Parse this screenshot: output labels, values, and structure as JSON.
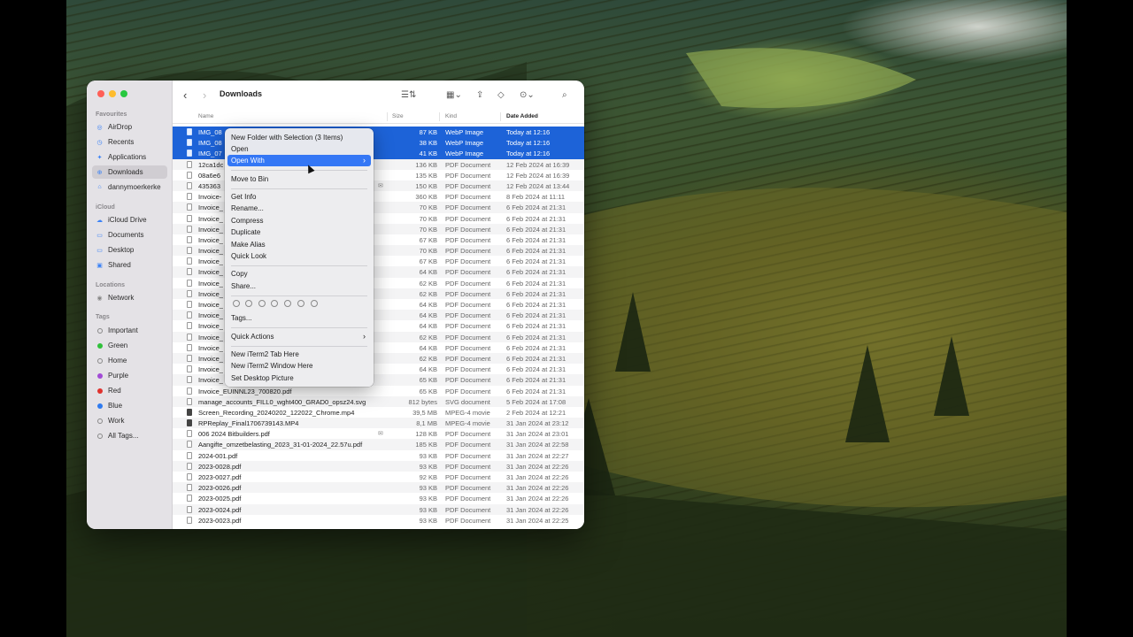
{
  "window": {
    "title": "Downloads"
  },
  "sidebar": {
    "favourites_label": "Favourites",
    "favourites": [
      {
        "label": "AirDrop",
        "icon": "airdrop-icon"
      },
      {
        "label": "Recents",
        "icon": "clock-icon"
      },
      {
        "label": "Applications",
        "icon": "applications-icon"
      },
      {
        "label": "Downloads",
        "icon": "download-icon",
        "active": true
      },
      {
        "label": "dannymoerkerke",
        "icon": "home-icon"
      }
    ],
    "icloud_label": "iCloud",
    "icloud": [
      {
        "label": "iCloud Drive",
        "icon": "cloud-icon"
      },
      {
        "label": "Documents",
        "icon": "document-icon"
      },
      {
        "label": "Desktop",
        "icon": "desktop-icon"
      },
      {
        "label": "Shared",
        "icon": "shared-folder-icon"
      }
    ],
    "locations_label": "Locations",
    "locations": [
      {
        "label": "Network",
        "icon": "network-icon"
      }
    ],
    "tags_label": "Tags",
    "tags": [
      {
        "label": "Important",
        "color": ""
      },
      {
        "label": "Green",
        "color": "#30c13b"
      },
      {
        "label": "Home",
        "color": ""
      },
      {
        "label": "Purple",
        "color": "#a24bd6"
      },
      {
        "label": "Red",
        "color": "#e0322e"
      },
      {
        "label": "Blue",
        "color": "#2f7bf0"
      },
      {
        "label": "Work",
        "color": ""
      },
      {
        "label": "All Tags...",
        "color": ""
      }
    ]
  },
  "columns": {
    "name": "Name",
    "size": "Size",
    "kind": "Kind",
    "date": "Date Added"
  },
  "files": [
    {
      "name": "IMG_08",
      "size": "87 KB",
      "kind": "WebP Image",
      "date": "Today at 12:16",
      "selected": true
    },
    {
      "name": "IMG_08",
      "size": "38 KB",
      "kind": "WebP Image",
      "date": "Today at 12:16",
      "selected": true
    },
    {
      "name": "IMG_07",
      "size": "41 KB",
      "kind": "WebP Image",
      "date": "Today at 12:16",
      "selected": true
    },
    {
      "name": "12ca1dc",
      "size": "136 KB",
      "kind": "PDF Document",
      "date": "12 Feb 2024 at 16:39"
    },
    {
      "name": "08a6e6",
      "size": "135 KB",
      "kind": "PDF Document",
      "date": "12 Feb 2024 at 16:39"
    },
    {
      "name": "435363",
      "size": "150 KB",
      "kind": "PDF Document",
      "date": "12 Feb 2024 at 13:44",
      "mail": true
    },
    {
      "name": "Invoice-",
      "size": "360 KB",
      "kind": "PDF Document",
      "date": "8 Feb 2024 at 11:11"
    },
    {
      "name": "Invoice_",
      "size": "70 KB",
      "kind": "PDF Document",
      "date": "6 Feb 2024 at 21:31"
    },
    {
      "name": "Invoice_",
      "size": "70 KB",
      "kind": "PDF Document",
      "date": "6 Feb 2024 at 21:31"
    },
    {
      "name": "Invoice_",
      "size": "70 KB",
      "kind": "PDF Document",
      "date": "6 Feb 2024 at 21:31"
    },
    {
      "name": "Invoice_",
      "size": "67 KB",
      "kind": "PDF Document",
      "date": "6 Feb 2024 at 21:31"
    },
    {
      "name": "Invoice_",
      "size": "70 KB",
      "kind": "PDF Document",
      "date": "6 Feb 2024 at 21:31"
    },
    {
      "name": "Invoice_",
      "size": "67 KB",
      "kind": "PDF Document",
      "date": "6 Feb 2024 at 21:31"
    },
    {
      "name": "Invoice_",
      "size": "64 KB",
      "kind": "PDF Document",
      "date": "6 Feb 2024 at 21:31"
    },
    {
      "name": "Invoice_",
      "size": "62 KB",
      "kind": "PDF Document",
      "date": "6 Feb 2024 at 21:31"
    },
    {
      "name": "Invoice_",
      "size": "62 KB",
      "kind": "PDF Document",
      "date": "6 Feb 2024 at 21:31"
    },
    {
      "name": "Invoice_",
      "size": "64 KB",
      "kind": "PDF Document",
      "date": "6 Feb 2024 at 21:31"
    },
    {
      "name": "Invoice_",
      "size": "64 KB",
      "kind": "PDF Document",
      "date": "6 Feb 2024 at 21:31"
    },
    {
      "name": "Invoice_",
      "size": "64 KB",
      "kind": "PDF Document",
      "date": "6 Feb 2024 at 21:31"
    },
    {
      "name": "Invoice_",
      "size": "62 KB",
      "kind": "PDF Document",
      "date": "6 Feb 2024 at 21:31"
    },
    {
      "name": "Invoice_",
      "size": "64 KB",
      "kind": "PDF Document",
      "date": "6 Feb 2024 at 21:31"
    },
    {
      "name": "Invoice_",
      "size": "62 KB",
      "kind": "PDF Document",
      "date": "6 Feb 2024 at 21:31"
    },
    {
      "name": "Invoice_",
      "size": "64 KB",
      "kind": "PDF Document",
      "date": "6 Feb 2024 at 21:31"
    },
    {
      "name": "Invoice_",
      "size": "65 KB",
      "kind": "PDF Document",
      "date": "6 Feb 2024 at 21:31"
    },
    {
      "name": "Invoice_EUINNL23_700820.pdf",
      "size": "65 KB",
      "kind": "PDF Document",
      "date": "6 Feb 2024 at 21:31"
    },
    {
      "name": "manage_accounts_FILL0_wght400_GRAD0_opsz24.svg",
      "size": "812 bytes",
      "kind": "SVG document",
      "date": "5 Feb 2024 at 17:08"
    },
    {
      "name": "Screen_Recording_20240202_122022_Chrome.mp4",
      "size": "39,5 MB",
      "kind": "MPEG-4 movie",
      "date": "2 Feb 2024 at 12:21",
      "movie": true
    },
    {
      "name": "RPReplay_Final1706739143.MP4",
      "size": "8,1 MB",
      "kind": "MPEG-4 movie",
      "date": "31 Jan 2024 at 23:12",
      "movie": true
    },
    {
      "name": "006 2024 Bitbuilders.pdf",
      "size": "128 KB",
      "kind": "PDF Document",
      "date": "31 Jan 2024 at 23:01",
      "mail": true
    },
    {
      "name": "Aangifte_omzetbelasting_2023_31-01-2024_22.57u.pdf",
      "size": "185 KB",
      "kind": "PDF Document",
      "date": "31 Jan 2024 at 22:58"
    },
    {
      "name": "2024-001.pdf",
      "size": "93 KB",
      "kind": "PDF Document",
      "date": "31 Jan 2024 at 22:27"
    },
    {
      "name": "2023-0028.pdf",
      "size": "93 KB",
      "kind": "PDF Document",
      "date": "31 Jan 2024 at 22:26"
    },
    {
      "name": "2023-0027.pdf",
      "size": "92 KB",
      "kind": "PDF Document",
      "date": "31 Jan 2024 at 22:26"
    },
    {
      "name": "2023-0026.pdf",
      "size": "93 KB",
      "kind": "PDF Document",
      "date": "31 Jan 2024 at 22:26"
    },
    {
      "name": "2023-0025.pdf",
      "size": "93 KB",
      "kind": "PDF Document",
      "date": "31 Jan 2024 at 22:26"
    },
    {
      "name": "2023-0024.pdf",
      "size": "93 KB",
      "kind": "PDF Document",
      "date": "31 Jan 2024 at 22:26"
    },
    {
      "name": "2023-0023.pdf",
      "size": "93 KB",
      "kind": "PDF Document",
      "date": "31 Jan 2024 at 22:25"
    }
  ],
  "context_menu": {
    "new_folder": "New Folder with Selection (3 Items)",
    "open": "Open",
    "open_with": "Open With",
    "move_to_bin": "Move to Bin",
    "get_info": "Get Info",
    "rename": "Rename...",
    "compress": "Compress",
    "duplicate": "Duplicate",
    "make_alias": "Make Alias",
    "quick_look": "Quick Look",
    "copy": "Copy",
    "share": "Share...",
    "tags": "Tags...",
    "quick_actions": "Quick Actions",
    "new_iterm_tab": "New iTerm2 Tab Here",
    "new_iterm_window": "New iTerm2 Window Here",
    "set_desktop": "Set Desktop Picture",
    "submenu_arrow": "›"
  },
  "colors": {
    "selection": "#1d63d8",
    "menu_highlight": "#3477f5",
    "accent": "#3b82f6"
  }
}
